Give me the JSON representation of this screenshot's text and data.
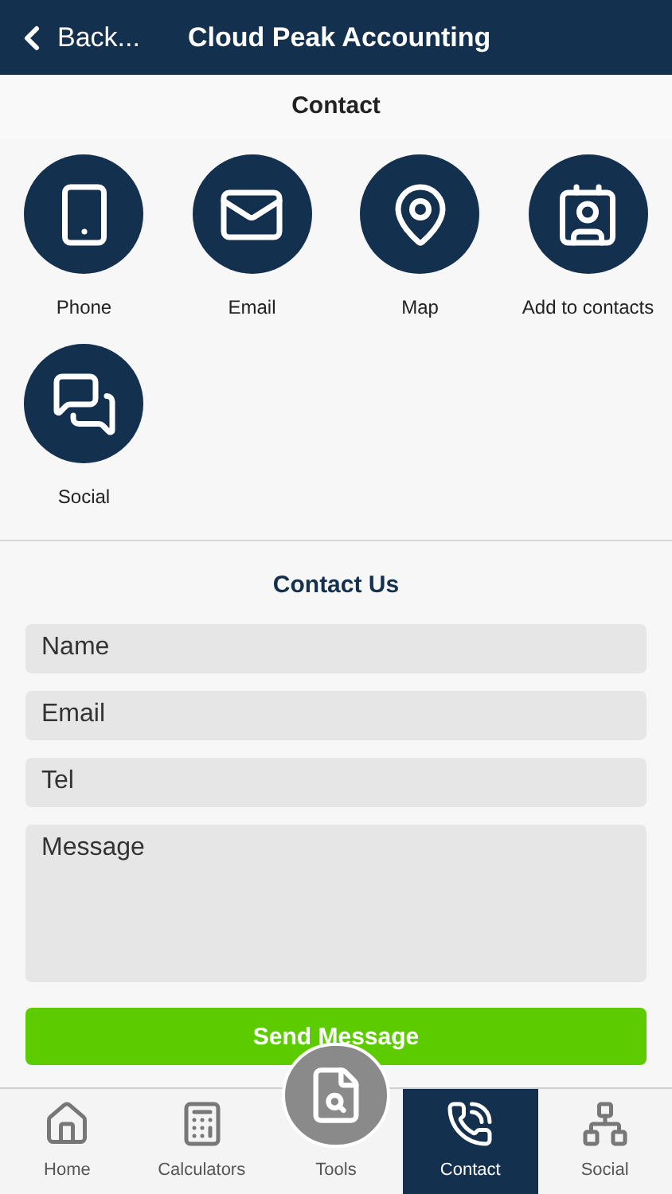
{
  "header": {
    "back": "Back...",
    "title": "Cloud Peak Accounting"
  },
  "section_title": "Contact",
  "contact_items": [
    {
      "kind": "phone",
      "label": "Phone"
    },
    {
      "kind": "email",
      "label": "Email"
    },
    {
      "kind": "map",
      "label": "Map"
    },
    {
      "kind": "contacts",
      "label": "Add to contacts"
    },
    {
      "kind": "social",
      "label": "Social"
    }
  ],
  "form": {
    "title": "Contact Us",
    "fields": [
      {
        "kind": "line",
        "placeholder": "Name"
      },
      {
        "kind": "line",
        "placeholder": "Email"
      },
      {
        "kind": "line",
        "placeholder": "Tel"
      },
      {
        "kind": "area",
        "placeholder": "Message"
      }
    ],
    "submit": "Send Message"
  },
  "tabs": [
    {
      "kind": "home",
      "label": "Home",
      "selected": false
    },
    {
      "kind": "calculators",
      "label": "Calculators",
      "selected": false
    },
    {
      "kind": "tools",
      "label": "Tools",
      "selected": false
    },
    {
      "kind": "contact",
      "label": "Contact",
      "selected": true
    },
    {
      "kind": "social",
      "label": "Social",
      "selected": false
    }
  ]
}
